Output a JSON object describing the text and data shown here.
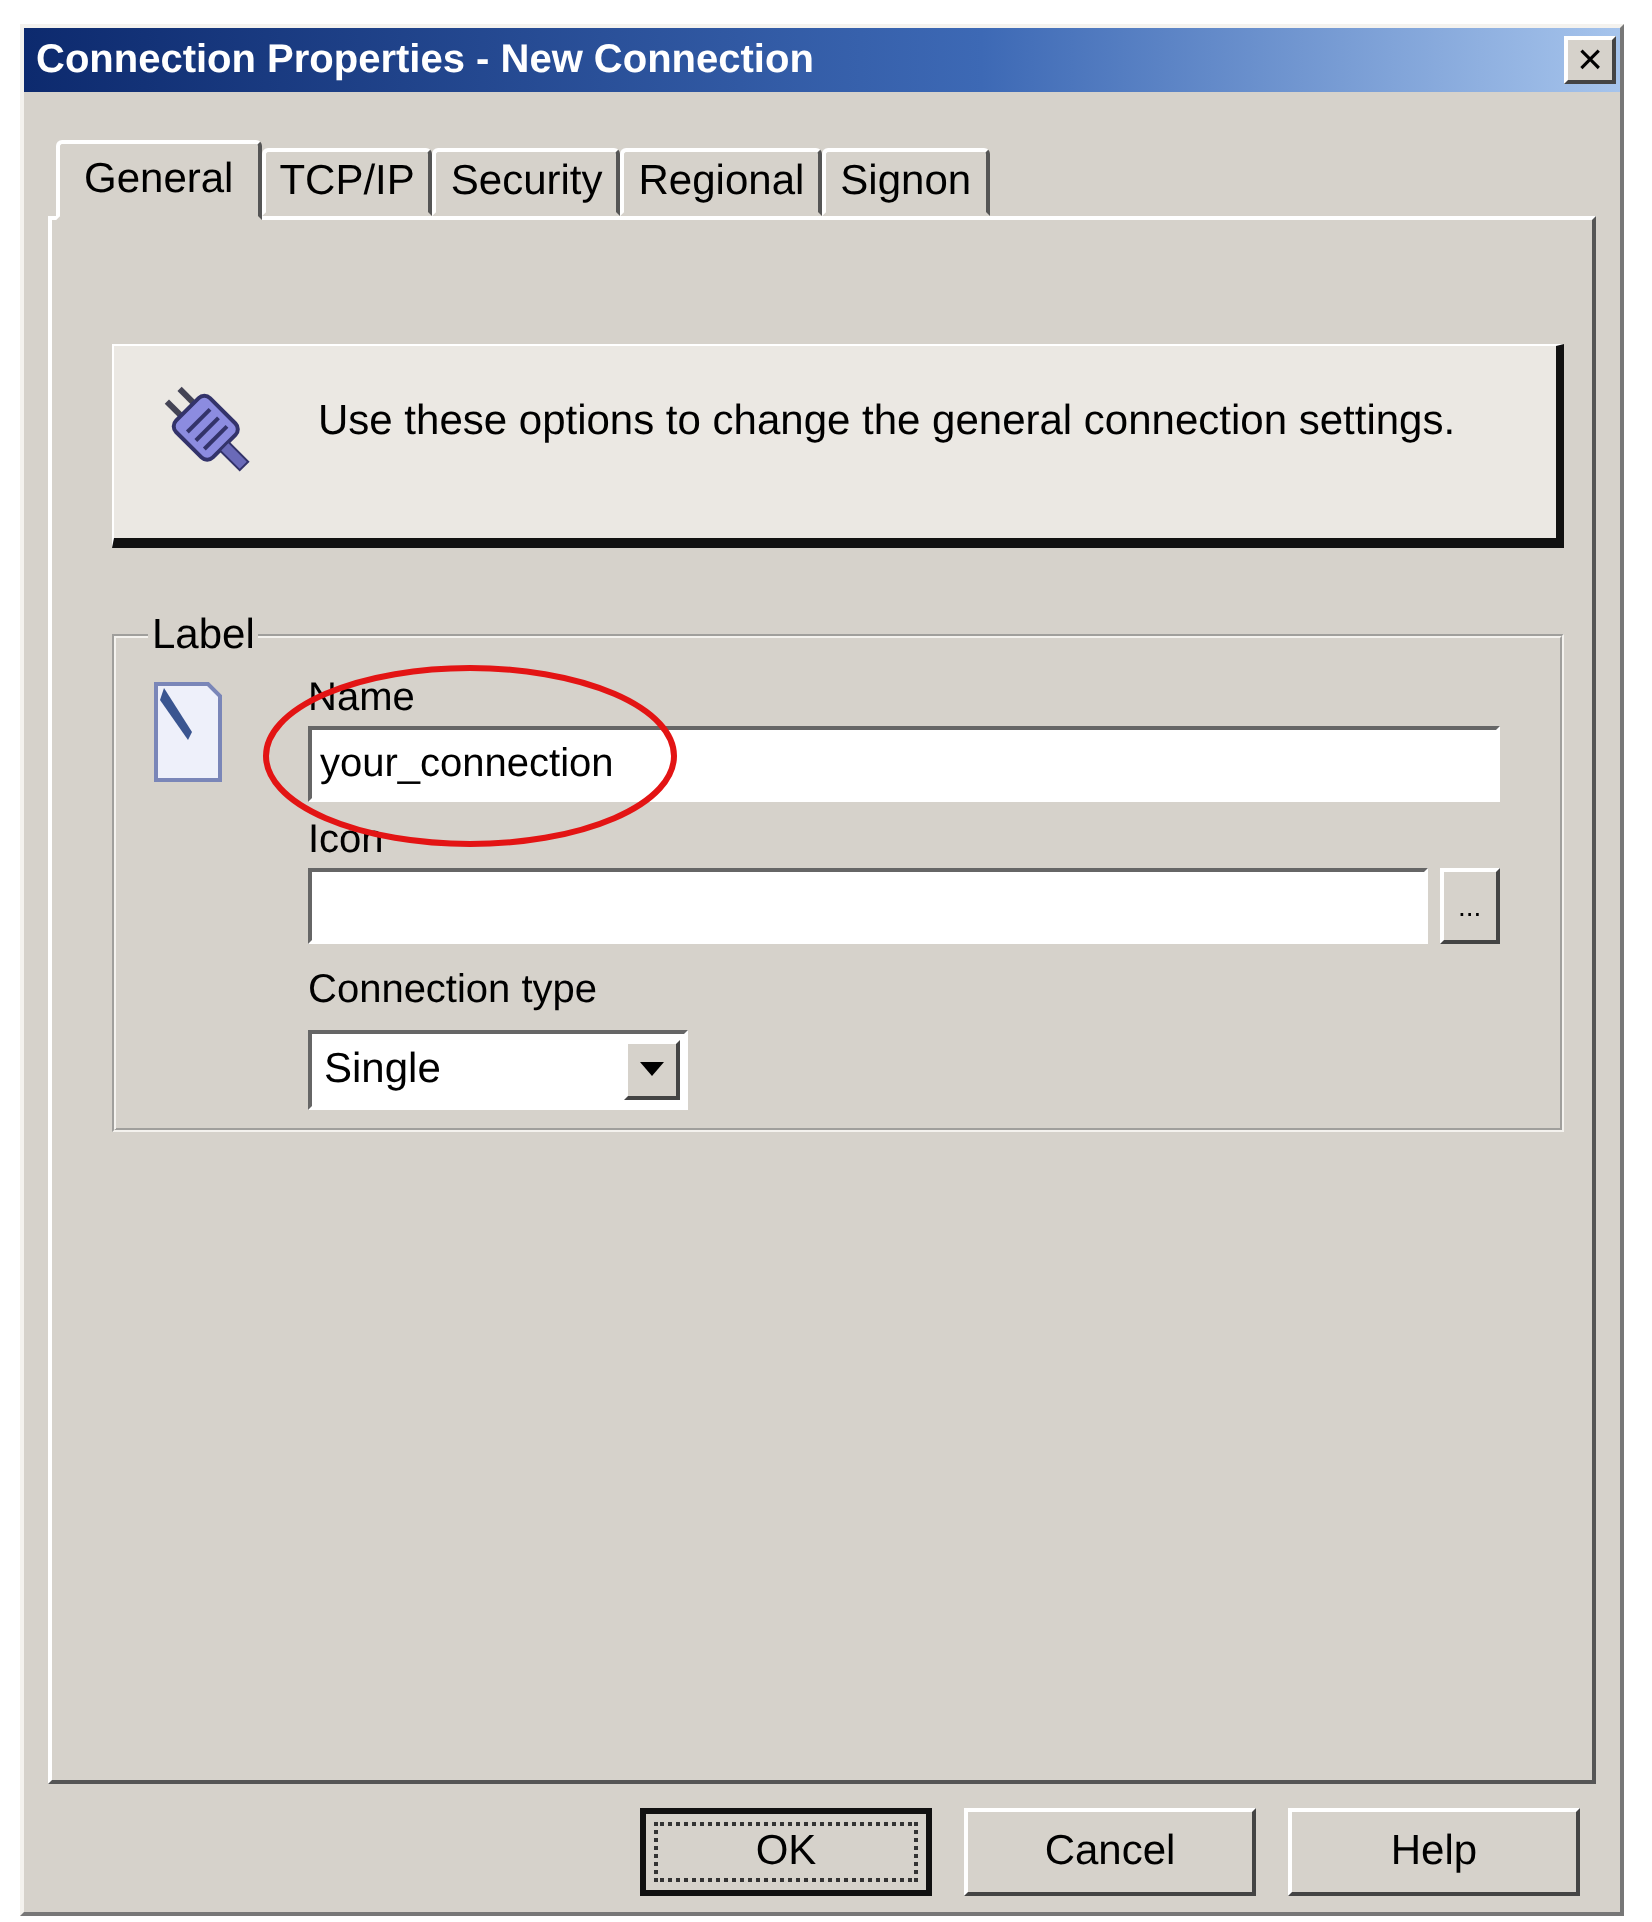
{
  "window": {
    "title": "Connection Properties - New Connection",
    "close": "×"
  },
  "tabs": [
    {
      "label": "General",
      "selected": true
    },
    {
      "label": "TCP/IP",
      "selected": false
    },
    {
      "label": "Security",
      "selected": false
    },
    {
      "label": "Regional",
      "selected": false
    },
    {
      "label": "Signon",
      "selected": false
    }
  ],
  "banner": {
    "text": "Use these options to change the general connection settings."
  },
  "group": {
    "title": "Label",
    "name": {
      "label": "Name",
      "value": "your_connection",
      "highlighted": true
    },
    "icon": {
      "label": "Icon",
      "browse": "..."
    },
    "connection_type": {
      "label": "Connection type",
      "value": "Single"
    }
  },
  "buttons": [
    {
      "label": "OK",
      "default": true
    },
    {
      "label": "Cancel",
      "default": false
    },
    {
      "label": "Help",
      "default": false
    }
  ]
}
